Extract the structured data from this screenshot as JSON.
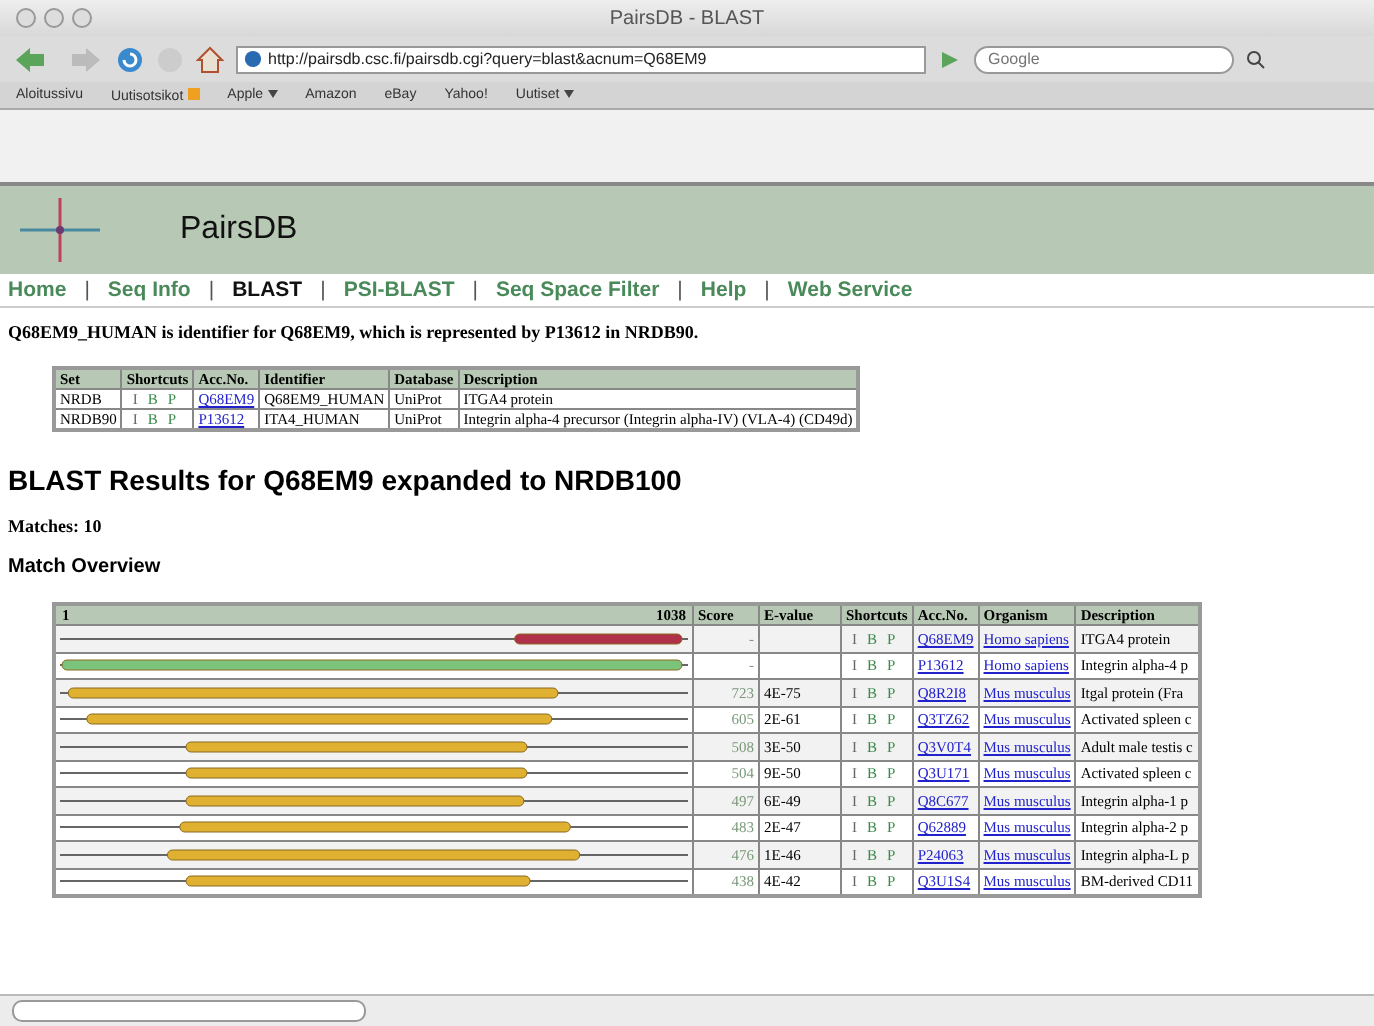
{
  "window": {
    "title": "PairsDB - BLAST"
  },
  "toolbar": {
    "url": "http://pairsdb.csc.fi/pairsdb.cgi?query=blast&acnum=Q68EM9",
    "search_placeholder": "Google"
  },
  "bookmarks": [
    {
      "label": "Aloitussivu",
      "kind": "plain"
    },
    {
      "label": "Uutisotsikot",
      "kind": "feed"
    },
    {
      "label": "Apple",
      "kind": "menu"
    },
    {
      "label": "Amazon",
      "kind": "plain"
    },
    {
      "label": "eBay",
      "kind": "plain"
    },
    {
      "label": "Yahoo!",
      "kind": "plain"
    },
    {
      "label": "Uutiset",
      "kind": "menu"
    }
  ],
  "site": {
    "name": "PairsDB"
  },
  "nav": [
    {
      "label": "Home",
      "selected": false
    },
    {
      "label": "Seq Info",
      "selected": false
    },
    {
      "label": "BLAST",
      "selected": true
    },
    {
      "label": "PSI-BLAST",
      "selected": false
    },
    {
      "label": "Seq Space Filter",
      "selected": false
    },
    {
      "label": "Help",
      "selected": false
    },
    {
      "label": "Web Service",
      "selected": false
    }
  ],
  "nav_separator": "|",
  "intro": "Q68EM9_HUMAN is identifier for Q68EM9, which is represented by P13612 in NRDB90.",
  "identity_table": {
    "columns": [
      "Set",
      "Shortcuts",
      "Acc.No.",
      "Identifier",
      "Database",
      "Description"
    ],
    "rows": [
      {
        "set": "NRDB",
        "shortcuts": [
          "I",
          "B",
          "P"
        ],
        "acc": "Q68EM9",
        "identifier": "Q68EM9_HUMAN",
        "database": "UniProt",
        "description": "ITGA4 protein"
      },
      {
        "set": "NRDB90",
        "shortcuts": [
          "I",
          "B",
          "P"
        ],
        "acc": "P13612",
        "identifier": "ITA4_HUMAN",
        "database": "UniProt",
        "description": "Integrin alpha-4 precursor (Integrin alpha-IV) (VLA-4) (CD49d)"
      }
    ]
  },
  "heading": "BLAST Results for Q68EM9 expanded to NRDB100",
  "matches": "Matches: 10",
  "overview_title": "Match Overview",
  "results": {
    "axis_start": "1",
    "axis_end": "1038",
    "columns": [
      "Score",
      "E-value",
      "Shortcuts",
      "Acc.No.",
      "Organism",
      "Description"
    ],
    "rows": [
      {
        "color": "#b0304a",
        "score": "-",
        "evalue": "",
        "shortcuts": [
          "I",
          "B",
          "P"
        ],
        "acc": "Q68EM9",
        "organism": "Homo sapiens",
        "description": "ITGA4 protein"
      },
      {
        "color": "#7cc47c",
        "score": "-",
        "evalue": "",
        "shortcuts": [
          "I",
          "B",
          "P"
        ],
        "acc": "P13612",
        "organism": "Homo sapiens",
        "description": "Integrin alpha-4 p"
      },
      {
        "color": "#e0b030",
        "score": "723",
        "evalue": "4E-75",
        "shortcuts": [
          "I",
          "B",
          "P"
        ],
        "acc": "Q8R2I8",
        "organism": "Mus musculus",
        "description": "Itgal protein (Fra"
      },
      {
        "color": "#e0b030",
        "score": "605",
        "evalue": "2E-61",
        "shortcuts": [
          "I",
          "B",
          "P"
        ],
        "acc": "Q3TZ62",
        "organism": "Mus musculus",
        "description": "Activated spleen c"
      },
      {
        "color": "#e0b030",
        "score": "508",
        "evalue": "3E-50",
        "shortcuts": [
          "I",
          "B",
          "P"
        ],
        "acc": "Q3V0T4",
        "organism": "Mus musculus",
        "description": "Adult male testis c"
      },
      {
        "color": "#e0b030",
        "score": "504",
        "evalue": "9E-50",
        "shortcuts": [
          "I",
          "B",
          "P"
        ],
        "acc": "Q3U171",
        "organism": "Mus musculus",
        "description": "Activated spleen c"
      },
      {
        "color": "#e0b030",
        "score": "497",
        "evalue": "6E-49",
        "shortcuts": [
          "I",
          "B",
          "P"
        ],
        "acc": "Q8C677",
        "organism": "Mus musculus",
        "description": "Integrin alpha-1 p"
      },
      {
        "color": "#e0b030",
        "score": "483",
        "evalue": "2E-47",
        "shortcuts": [
          "I",
          "B",
          "P"
        ],
        "acc": "Q62889",
        "organism": "Mus musculus",
        "description": "Integrin alpha-2 p"
      },
      {
        "color": "#e0b030",
        "score": "476",
        "evalue": "1E-46",
        "shortcuts": [
          "I",
          "B",
          "P"
        ],
        "acc": "P24063",
        "organism": "Mus musculus",
        "description": "Integrin alpha-L p"
      },
      {
        "color": "#e0b030",
        "score": "438",
        "evalue": "4E-42",
        "shortcuts": [
          "I",
          "B",
          "P"
        ],
        "acc": "Q3U1S4",
        "organism": "Mus musculus",
        "description": "BM-derived CD11"
      }
    ]
  }
}
